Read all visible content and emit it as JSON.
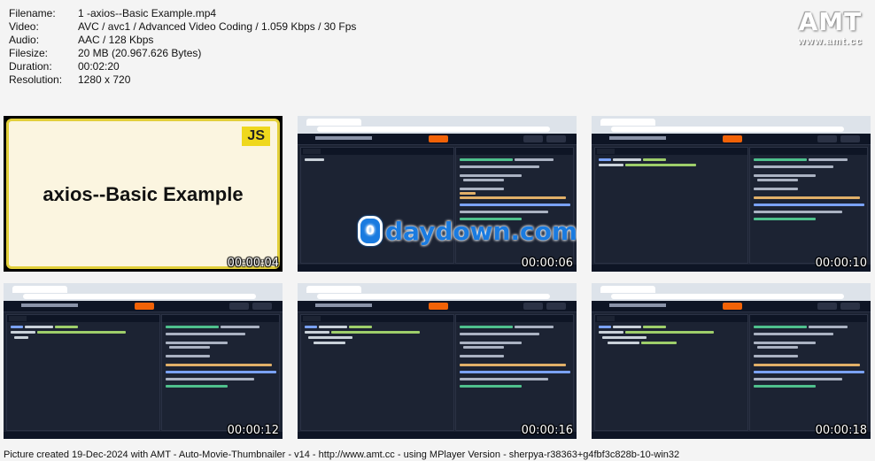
{
  "info": [
    {
      "key": "Filename:",
      "value": "1 -axios--Basic Example.mp4"
    },
    {
      "key": "Video:",
      "value": "AVC / avc1 / Advanced Video Coding / 1.059 Kbps / 30 Fps"
    },
    {
      "key": "Audio:",
      "value": "AAC / 128 Kbps"
    },
    {
      "key": "Filesize:",
      "value": "20 MB (20.967.626 Bytes)"
    },
    {
      "key": "Duration:",
      "value": "00:02:20"
    },
    {
      "key": "Resolution:",
      "value": "1280 x 720"
    }
  ],
  "brand": {
    "logo": "AMT",
    "url": "www.amt.cc"
  },
  "title_card": {
    "title": "axios--Basic Example",
    "badge": "JS"
  },
  "thumbnails": [
    {
      "timestamp": "00:00:04"
    },
    {
      "timestamp": "00:00:06"
    },
    {
      "timestamp": "00:00:10"
    },
    {
      "timestamp": "00:00:12"
    },
    {
      "timestamp": "00:00:16"
    },
    {
      "timestamp": "00:00:18"
    }
  ],
  "watermark": {
    "text": "daydown.com",
    "icon": "0"
  },
  "footer": "Picture created 19-Dec-2024 with AMT - Auto-Movie-Thumbnailer - v14 - http://www.amt.cc - using MPlayer Version - sherpya-r38363+g4fbf3c828b-10-win32",
  "colors": {
    "run_button": "#f26207",
    "editor_bg": "#1c2333",
    "title_border": "#e2cf3a"
  }
}
